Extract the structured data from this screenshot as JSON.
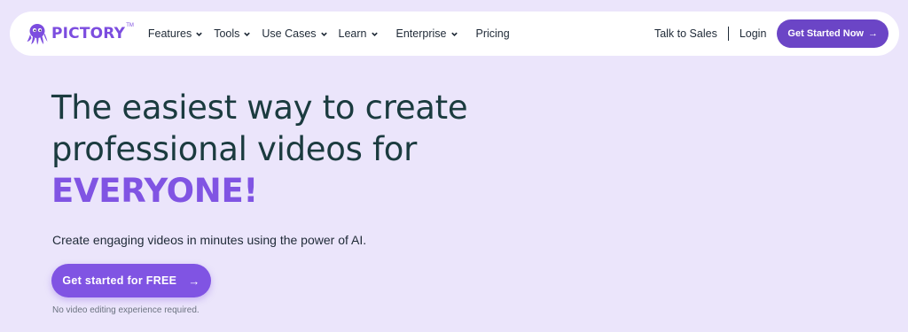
{
  "brand": {
    "name": "PICTORY",
    "trademark": "TM",
    "logo_icon": "octopus-icon",
    "color": "#7c4ddf"
  },
  "nav": {
    "items": [
      {
        "label": "Features",
        "dropdown": true
      },
      {
        "label": "Tools",
        "dropdown": true
      },
      {
        "label": "Use Cases",
        "dropdown": true
      },
      {
        "label": "Learn",
        "dropdown": true
      },
      {
        "label": "Enterprise",
        "dropdown": true
      },
      {
        "label": "Pricing",
        "dropdown": false
      }
    ],
    "talk_to_sales": "Talk to Sales",
    "separator": "|",
    "login": "Login",
    "cta_label": "Get Started Now",
    "cta_icon": "arrow-right-icon",
    "cta_color": "#6b45c6"
  },
  "hero": {
    "title_line1": "The easiest way to create",
    "title_line2": "professional videos for",
    "title_accent": "EVERYONE!",
    "accent_color": "#8054e3",
    "subtitle": "Create engaging videos in minutes using the power of AI.",
    "cta_label": "Get started for FREE",
    "cta_icon": "arrow-right-icon",
    "note": "No video editing experience required."
  },
  "colors": {
    "page_background": "#ebe5fb",
    "heading": "#1b3b3f"
  }
}
